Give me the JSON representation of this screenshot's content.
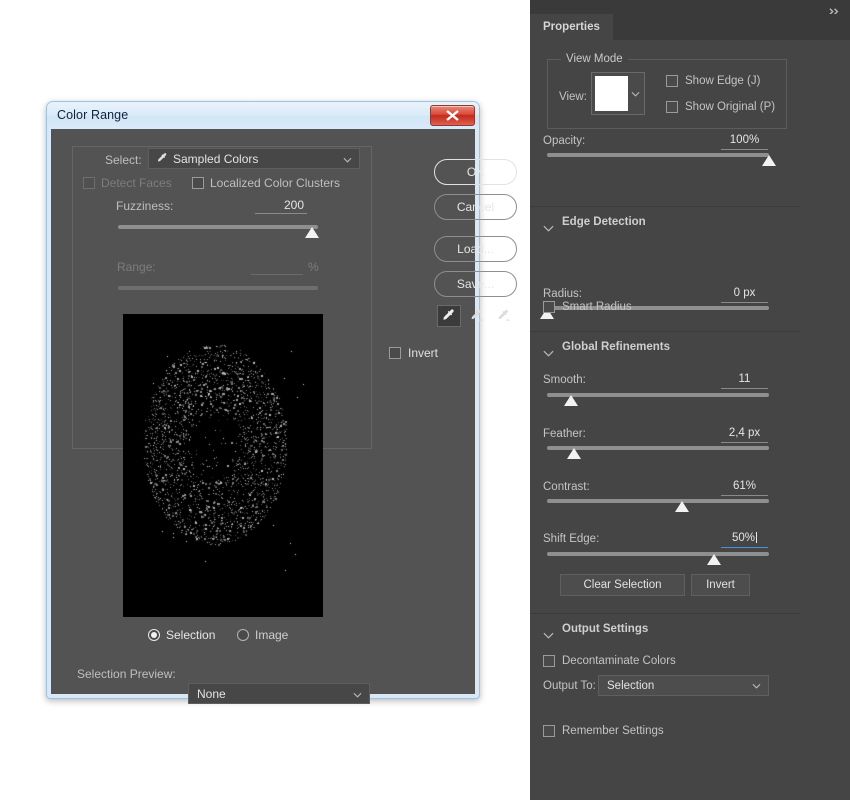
{
  "color_range_dialog": {
    "title": "Color Range",
    "close_icon": "close-x-icon",
    "select_label": "Select:",
    "select_value": "Sampled Colors",
    "select_icon": "eyedropper-icon",
    "detect_faces_label": "Detect Faces",
    "detect_faces_checked": false,
    "detect_faces_enabled": false,
    "localized_clusters_label": "Localized Color Clusters",
    "localized_clusters_checked": false,
    "fuzziness_label": "Fuzziness:",
    "fuzziness_value": "200",
    "fuzziness_percent": 97,
    "range_label": "Range:",
    "range_value": "",
    "range_unit": "%",
    "range_enabled": false,
    "preview_radio_selection": "Selection",
    "preview_radio_image": "Image",
    "preview_mode_selected": "Selection",
    "selection_preview_label": "Selection Preview:",
    "selection_preview_value": "None",
    "buttons": {
      "ok": "OK",
      "cancel": "Cancel",
      "load": "Load...",
      "save": "Save..."
    },
    "eyedroppers": [
      {
        "name": "eyedropper-sample-icon",
        "selected": true
      },
      {
        "name": "eyedropper-add-icon",
        "selected": false
      },
      {
        "name": "eyedropper-subtract-icon",
        "selected": false
      }
    ],
    "invert_label": "Invert",
    "invert_checked": false
  },
  "properties_panel": {
    "collapse_icon": "double-chevron-right-icon",
    "tab_label": "Properties",
    "view_mode": {
      "group_title": "View Mode",
      "view_label": "View:",
      "view_swatch_color": "#ffffff",
      "show_edge_label": "Show Edge (J)",
      "show_edge_checked": false,
      "show_original_label": "Show Original (P)",
      "show_original_checked": false,
      "opacity_label": "Opacity:",
      "opacity_value": "100%",
      "opacity_percent": 100
    },
    "edge_detection": {
      "title": "Edge Detection",
      "radius_label": "Radius:",
      "radius_value": "0 px",
      "radius_percent": 0,
      "smart_radius_label": "Smart Radius",
      "smart_radius_checked": false
    },
    "global_refinements": {
      "title": "Global Refinements",
      "smooth_label": "Smooth:",
      "smooth_value": "11",
      "smooth_percent": 11,
      "feather_label": "Feather:",
      "feather_value": "2,4 px",
      "feather_percent": 12,
      "contrast_label": "Contrast:",
      "contrast_value": "61%",
      "contrast_percent": 61,
      "shift_edge_label": "Shift Edge:",
      "shift_edge_value": "50%",
      "shift_edge_percent": 75,
      "shift_edge_focused": true,
      "clear_selection_label": "Clear Selection",
      "invert_label": "Invert"
    },
    "output_settings": {
      "title": "Output Settings",
      "decontaminate_label": "Decontaminate Colors",
      "decontaminate_checked": false,
      "output_to_label": "Output To:",
      "output_to_value": "Selection",
      "remember_settings_label": "Remember Settings",
      "remember_settings_checked": false
    }
  },
  "colors": {
    "dialog_bg": "#535353",
    "panel_bg": "#454545",
    "accent_focus": "#4a90d9",
    "close_button": "#c22a1b"
  }
}
